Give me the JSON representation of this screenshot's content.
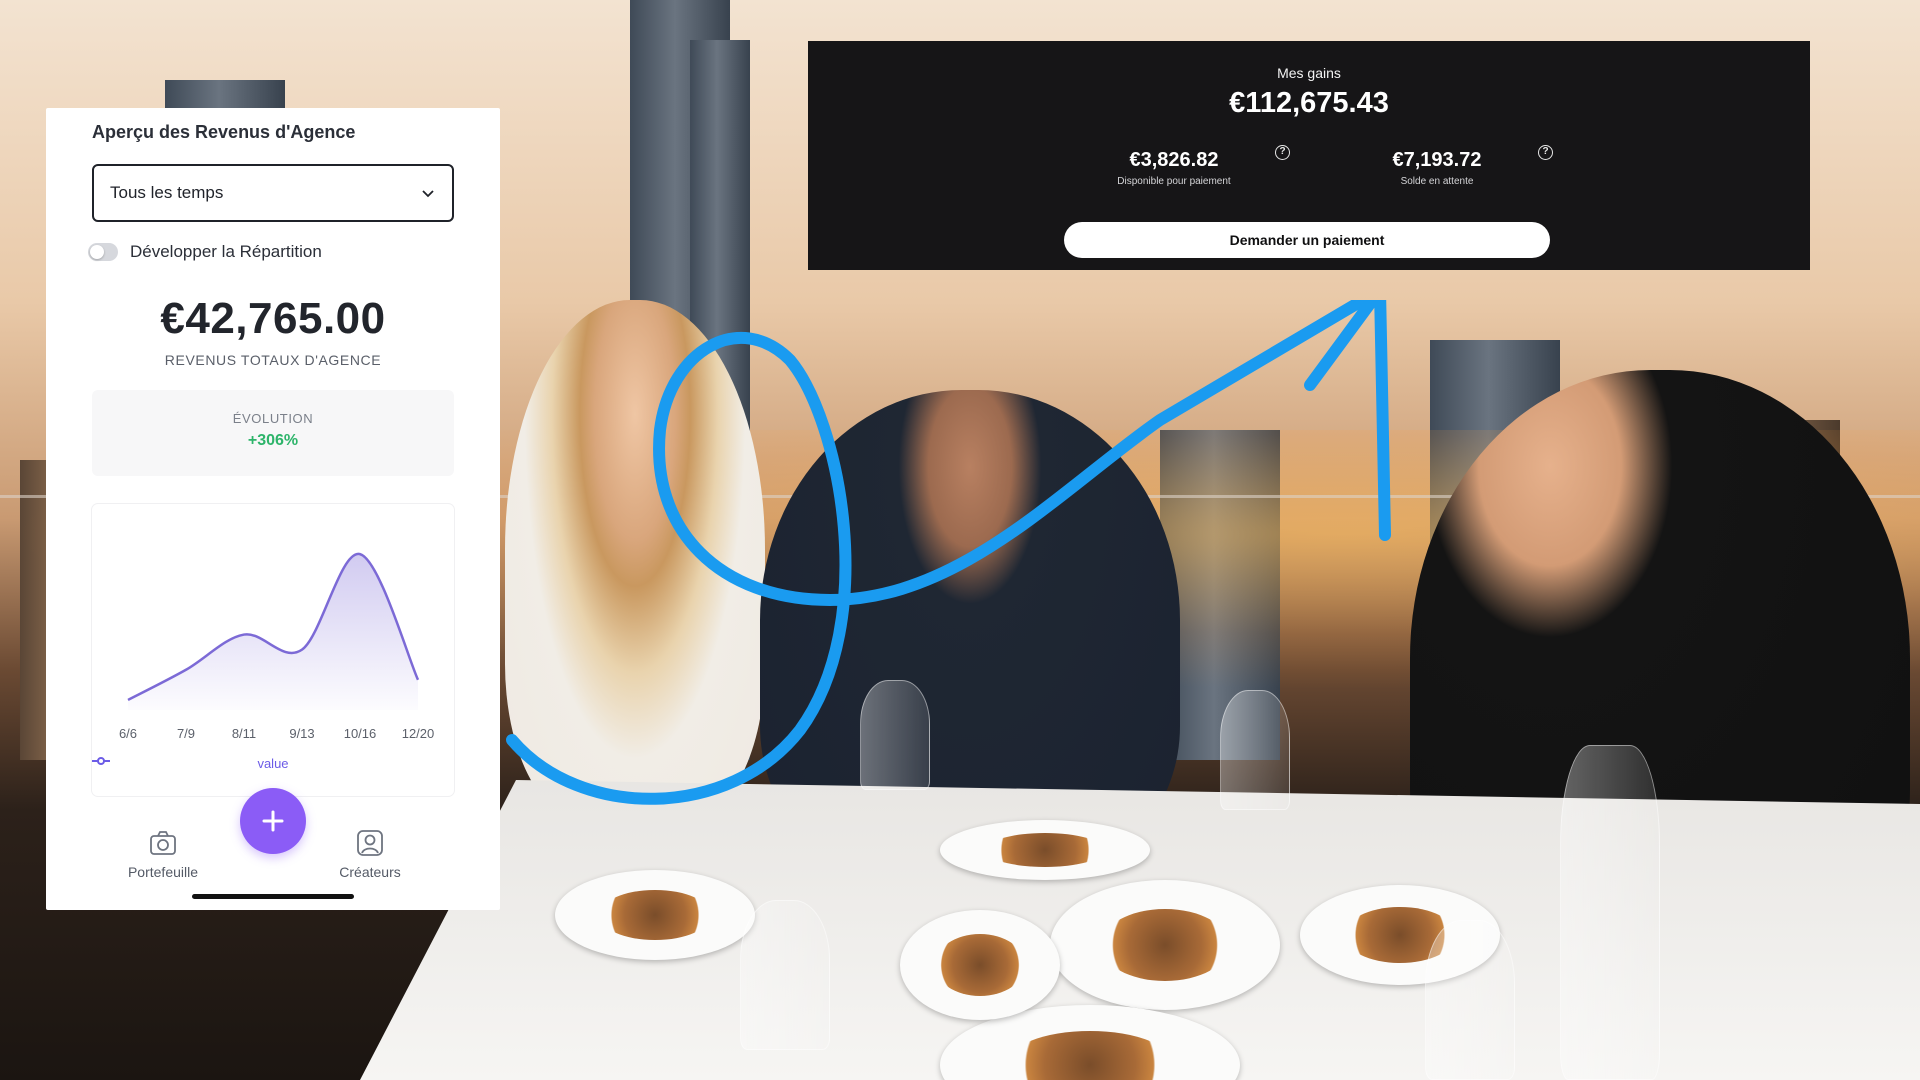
{
  "revenue_panel": {
    "title": "Aperçu des Revenus d'Agence",
    "period_select": {
      "selected": "Tous les temps"
    },
    "toggle": {
      "label": "Développer la Répartition",
      "on": false
    },
    "total_value": "€42,765.00",
    "total_label": "REVENUS TOTAUX D'AGENCE",
    "evolution": {
      "label": "ÉVOLUTION",
      "value": "+306%"
    },
    "legend_label": "value",
    "nav": {
      "wallet_label": "Portefeuille",
      "creators_label": "Créateurs"
    },
    "accent_color": "#8b5cf6",
    "positive_color": "#2db46a"
  },
  "chart_data": {
    "type": "area",
    "x": [
      "6/6",
      "7/9",
      "8/11",
      "9/13",
      "10/16",
      "12/20"
    ],
    "series": [
      {
        "name": "value",
        "values": [
          2,
          8,
          15,
          12,
          31,
          6
        ]
      }
    ],
    "xlabel": "",
    "ylabel": "",
    "ylim": [
      0,
      35
    ],
    "grid": false,
    "legend": "bottom",
    "color": "#7c6ad6"
  },
  "earnings_panel": {
    "label": "Mes gains",
    "total": "€112,675.43",
    "available": {
      "amount": "€3,826.82",
      "label": "Disponible pour paiement"
    },
    "pending": {
      "amount": "€7,193.72",
      "label": "Solde en attente"
    },
    "help_glyph": "?",
    "button_label": "Demander un paiement"
  },
  "overlay": {
    "arrow_color": "#1a9bf0",
    "icons": [
      "chevron-down-icon",
      "camera-wallet-icon",
      "plus-icon",
      "user-icon",
      "help-circle-icon"
    ]
  }
}
